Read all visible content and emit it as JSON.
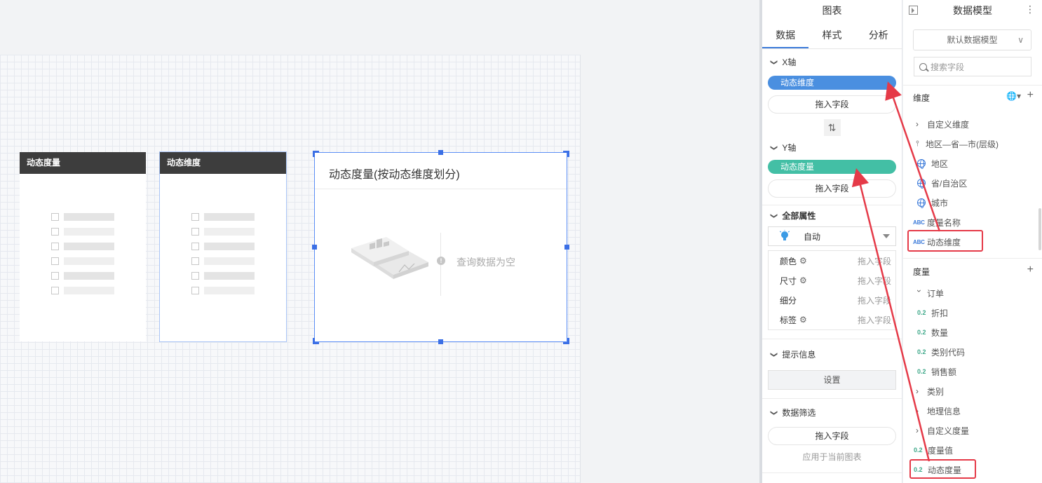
{
  "canvas": {
    "filter_card_1": {
      "title": "动态度量"
    },
    "filter_card_2": {
      "title": "动态维度"
    },
    "chart_card": {
      "title": "动态度量(按动态维度划分)",
      "empty_text": "查询数据为空"
    }
  },
  "chart_panel": {
    "title": "图表",
    "tabs": [
      {
        "label": "数据",
        "active": true
      },
      {
        "label": "样式"
      },
      {
        "label": "分析"
      }
    ],
    "x_axis": {
      "label": "X轴",
      "field": "动态维度",
      "drop": "拖入字段"
    },
    "y_axis": {
      "label": "Y轴",
      "field": "动态度量",
      "drop": "拖入字段"
    },
    "all_props": {
      "label": "全部属性",
      "chart_type": "自动",
      "rows": [
        {
          "name": "颜色",
          "hint": "拖入字段"
        },
        {
          "name": "尺寸",
          "hint": "拖入字段"
        },
        {
          "name": "细分",
          "hint": "拖入字段"
        },
        {
          "name": "标签",
          "hint": "拖入字段"
        }
      ]
    },
    "tooltip": {
      "label": "提示信息",
      "button": "设置"
    },
    "filter": {
      "label": "数据筛选",
      "drop": "拖入字段",
      "apply": "应用于当前图表"
    }
  },
  "data_model": {
    "title": "数据模型",
    "model_select": "默认数据模型",
    "search_placeholder": "搜索字段",
    "dimensions": {
      "label": "维度",
      "items": [
        {
          "label": "自定义维度",
          "icon": "chevron-right-icon"
        },
        {
          "label": "地区—省—市(层级)",
          "icon": "hierarchy-icon"
        },
        {
          "label": "地区",
          "icon": "globe-icon"
        },
        {
          "label": "省/自治区",
          "icon": "globe-icon"
        },
        {
          "label": "城市",
          "icon": "globe-icon"
        },
        {
          "label": "度量名称",
          "icon": "ABC"
        },
        {
          "label": "动态维度",
          "icon": "ABC"
        }
      ]
    },
    "measures": {
      "label": "度量",
      "items": [
        {
          "label": "订单",
          "icon": "chevron-down-icon"
        },
        {
          "label": "折扣",
          "icon": "0.2"
        },
        {
          "label": "数量",
          "icon": "0.2"
        },
        {
          "label": "类别代码",
          "icon": "0.2"
        },
        {
          "label": "销售额",
          "icon": "0.2"
        },
        {
          "label": "类别",
          "icon": "chevron-right-icon"
        },
        {
          "label": "地理信息",
          "icon": "chevron-right-icon"
        },
        {
          "label": "自定义度量",
          "icon": "chevron-right-icon"
        },
        {
          "label": "度量值",
          "icon": "0.2"
        },
        {
          "label": "动态度量",
          "icon": "0.2"
        }
      ]
    }
  },
  "colors": {
    "accent": "#3b7ad9",
    "x_pill": "#4a8fe0",
    "y_pill": "#43bfa5",
    "highlight": "#e53a48"
  }
}
